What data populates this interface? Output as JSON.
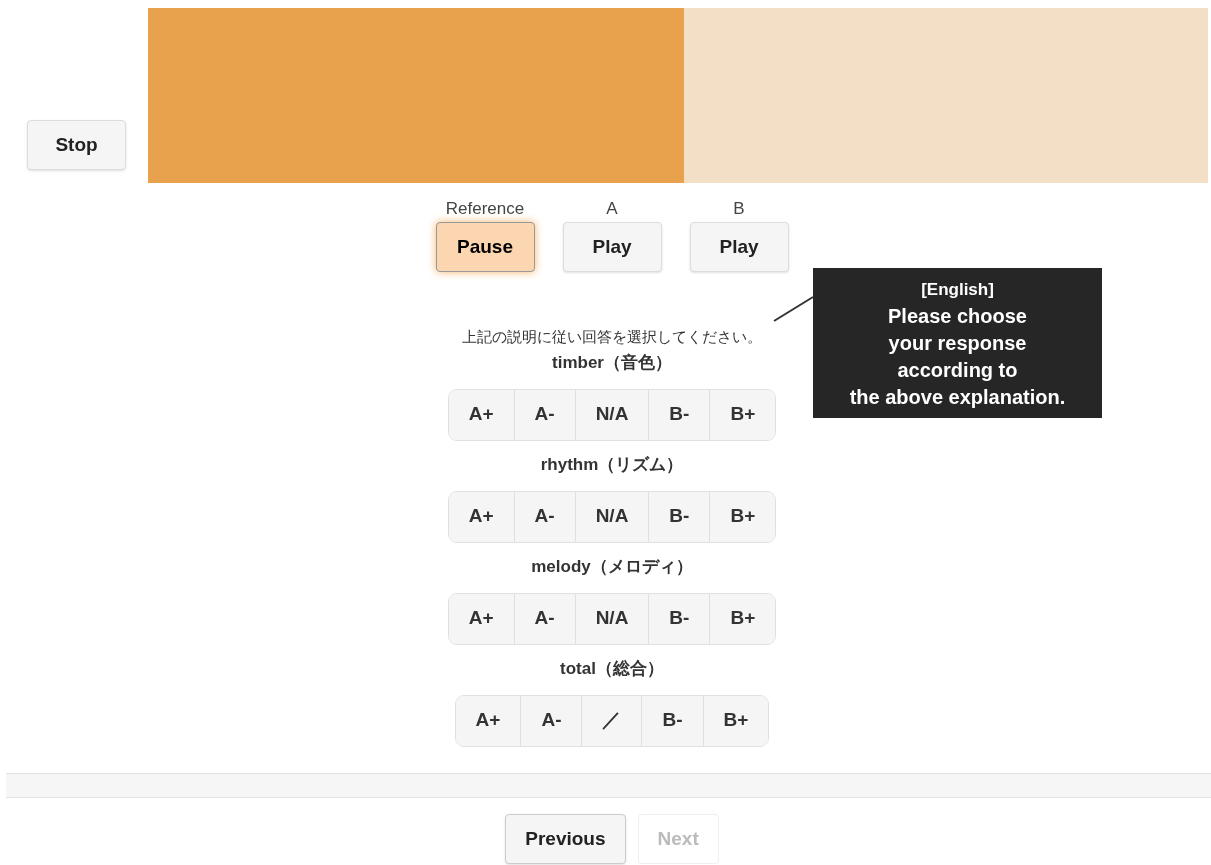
{
  "stop_button": "Stop",
  "progress": {
    "level": 0.506
  },
  "players": [
    {
      "label": "Reference",
      "button": "Pause",
      "playing": true
    },
    {
      "label": "A",
      "button": "Play",
      "playing": false
    },
    {
      "label": "B",
      "button": "Play",
      "playing": false
    }
  ],
  "instruction": "上記の説明に従い回答を選択してください。",
  "callout": {
    "lines": [
      "[English]",
      "Please choose",
      "your response",
      "according to",
      "the above explanation."
    ]
  },
  "questions": [
    {
      "title": "timber（音色）",
      "options": [
        {
          "label": "A+",
          "selected": false
        },
        {
          "label": "A-",
          "selected": false
        },
        {
          "label": "N/A",
          "selected": false
        },
        {
          "label": "B-",
          "selected": false
        },
        {
          "label": "B+",
          "selected": false
        }
      ]
    },
    {
      "title": "rhythm（リズム）",
      "options": [
        {
          "label": "A+",
          "selected": false
        },
        {
          "label": "A-",
          "selected": false
        },
        {
          "label": "N/A",
          "selected": false
        },
        {
          "label": "B-",
          "selected": false
        },
        {
          "label": "B+",
          "selected": false
        }
      ]
    },
    {
      "title": "melody（メロディ）",
      "options": [
        {
          "label": "A+",
          "selected": false
        },
        {
          "label": "A-",
          "selected": false
        },
        {
          "label": "N/A",
          "selected": false
        },
        {
          "label": "B-",
          "selected": false
        },
        {
          "label": "B+",
          "selected": false
        }
      ]
    },
    {
      "title": "total（総合）",
      "options": [
        {
          "label": "A+",
          "selected": false
        },
        {
          "label": "A-",
          "selected": false
        },
        {
          "label": "／",
          "selected": false
        },
        {
          "label": "B-",
          "selected": false
        },
        {
          "label": "B+",
          "selected": false
        }
      ]
    }
  ],
  "navigation": [
    {
      "label": "Previous",
      "disabled": false
    },
    {
      "label": "Next",
      "disabled": true
    }
  ]
}
